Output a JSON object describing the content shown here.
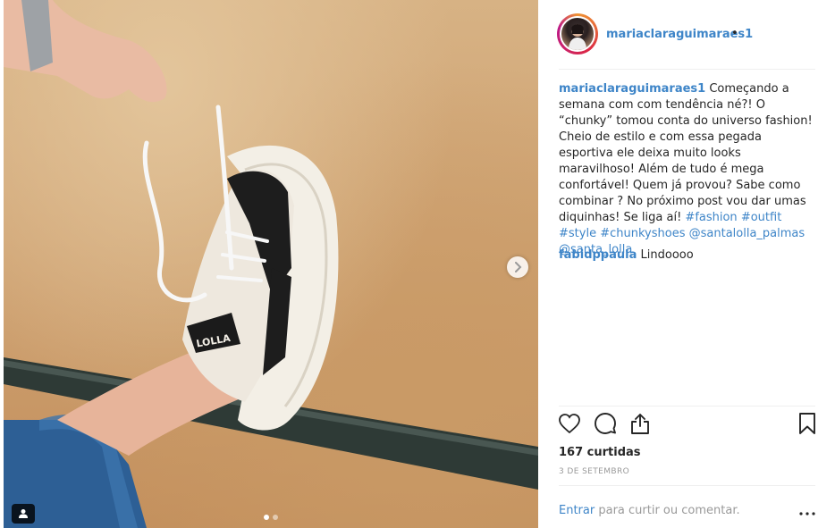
{
  "post": {
    "username": "mariaclaraguimaraes1",
    "follow_separator": "•",
    "caption": {
      "author": "mariaclaraguimaraes1",
      "text": "Começando a semana com com tendência né?! O “chunky” tomou conta do universo fashion! Cheio de estilo e com essa pegada esportiva ele deixa muito looks maravilhoso! Além de tudo é mega confortável! Quem já provou? Sabe como combinar ? No próximo post vou dar umas diquinhas! Se liga aí!",
      "hashtags": [
        "#fashion",
        "#outfit",
        "#style",
        "#chunkyshoes"
      ],
      "mentions": [
        "@santalolla_palmas",
        "@santa_lolla"
      ]
    },
    "comments": [
      {
        "author": "fabidppaula",
        "text": "Lindoooo"
      }
    ],
    "likes_text": "167 curtidas",
    "date_text": "3 DE SETEMBRO",
    "login": {
      "link": "Entrar",
      "rest": " para curtir ou comentar."
    },
    "shoe_brand_text": "LOLLA",
    "carousel": {
      "total": 2,
      "active": 1
    }
  },
  "icons": {
    "like": "heart-outline-icon",
    "comment": "speech-bubble-icon",
    "share": "share-icon",
    "save": "bookmark-icon",
    "more": "more-dots-icon",
    "next": "chevron-right-icon",
    "user_tag": "person-icon"
  },
  "colors": {
    "link": "#3e85c8",
    "text": "#262626",
    "muted": "#999999",
    "divider": "#efefef"
  }
}
